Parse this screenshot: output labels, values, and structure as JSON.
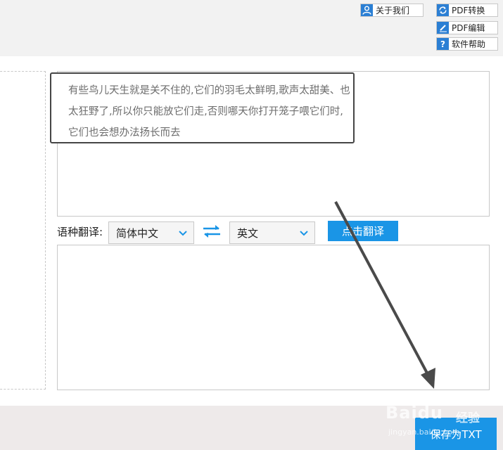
{
  "toolbar": {
    "about_label": "关于我们",
    "pdf_convert_label": "PDF转换",
    "pdf_edit_label": "PDF编辑",
    "help_label": "软件帮助"
  },
  "source": {
    "text": "有些鸟儿天生就是关不住的,它们的羽毛太鲜明,歌声太甜美、也太狂野了,所以你只能放它们走,否则哪天你打开笼子喂它们时,它们也会想办法扬长而去"
  },
  "translate": {
    "label": "语种翻译:",
    "from_lang": "简体中文",
    "to_lang": "英文",
    "button_label": "点击翻译"
  },
  "footer": {
    "save_label": "保存为TXT"
  },
  "watermark": {
    "brand": "Baidu",
    "brand_cn": "经验",
    "url": "jingyan.baidu.com"
  },
  "colors": {
    "accent": "#1a95e6",
    "icon_blue": "#2b7fd4"
  }
}
